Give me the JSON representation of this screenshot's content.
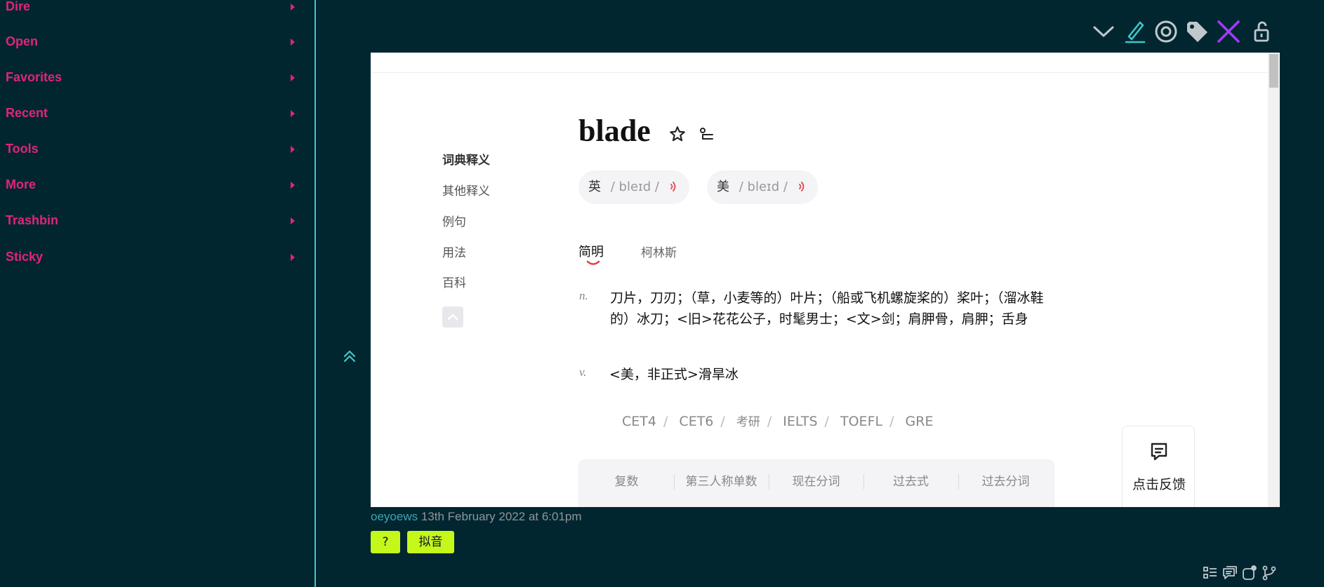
{
  "sidebar": {
    "items": [
      {
        "label": "Dire"
      },
      {
        "label": "Open"
      },
      {
        "label": "Favorites"
      },
      {
        "label": "Recent"
      },
      {
        "label": "Tools"
      },
      {
        "label": "More"
      },
      {
        "label": "Trashbin"
      },
      {
        "label": "Sticky"
      }
    ]
  },
  "toolbar": {
    "icons": [
      "chevron-down-icon",
      "pen-icon",
      "target-icon",
      "tag-icon",
      "close-icon",
      "unlock-icon"
    ]
  },
  "dictionary": {
    "nav": [
      "词典释义",
      "其他释义",
      "例句",
      "用法",
      "百科"
    ],
    "word": "blade",
    "phonetics": [
      {
        "region": "英",
        "ipa": "/ bleɪd /"
      },
      {
        "region": "美",
        "ipa": "/ bleɪd /"
      }
    ],
    "tabs": [
      "简明",
      "柯林斯"
    ],
    "definitions": [
      {
        "pos": "n.",
        "text": "刀片，刀刃；（草，小麦等的）叶片；（船或飞机螺旋桨的）桨叶；（溜冰鞋的）冰刀；<旧>花花公子，时髦男士；<文>剑；肩胛骨，肩胛；舌身"
      },
      {
        "pos": "v.",
        "text": "<美，非正式>滑旱冰"
      }
    ],
    "exams": [
      "CET4",
      "CET6",
      "考研",
      "IELTS",
      "TOEFL",
      "GRE"
    ],
    "forms_header": [
      "复数",
      "第三人称单数",
      "现在分词",
      "过去式",
      "过去分词"
    ],
    "feedback_label": "点击反馈"
  },
  "meta": {
    "author": "oeyoews",
    "date": "13th February 2022 at 6:01pm"
  },
  "tags": [
    "?",
    "拟音"
  ],
  "colors": {
    "background": "#022630",
    "accent_pink": "#e0247e",
    "accent_cyan": "#3fc6c8",
    "close_purple": "#9b3ff0",
    "tag_lime": "#c4f71a"
  }
}
